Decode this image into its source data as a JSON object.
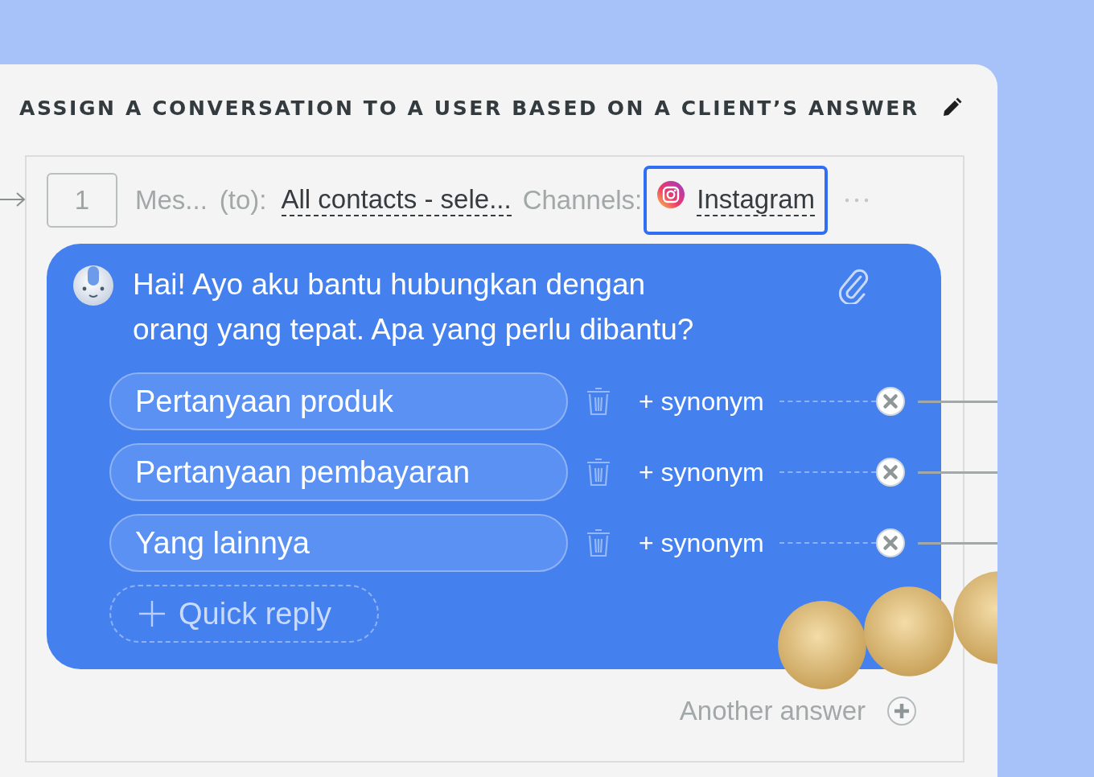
{
  "title": "ASSIGN A CONVERSATION TO A USER BASED ON A CLIENT’S ANSWER",
  "step": {
    "number": "1",
    "message_label": "Mes...",
    "to_label": "(to):",
    "recipients": "All contacts - sele...",
    "channels_label": "Channels:",
    "channel": {
      "name": "Instagram",
      "selected": true
    }
  },
  "message": {
    "text": "Hai! Ayo aku bantu hubungkan dengan\norang yang tepat. Apa yang perlu dibantu?"
  },
  "quick_replies": [
    {
      "label": "Pertanyaan produk",
      "synonym": "+ synonym"
    },
    {
      "label": "Pertanyaan pembayaran",
      "synonym": "+ synonym"
    },
    {
      "label": "Yang lainnya",
      "synonym": "+ synonym"
    }
  ],
  "add_quick_reply": "Quick reply",
  "another_answer": "Another answer"
}
